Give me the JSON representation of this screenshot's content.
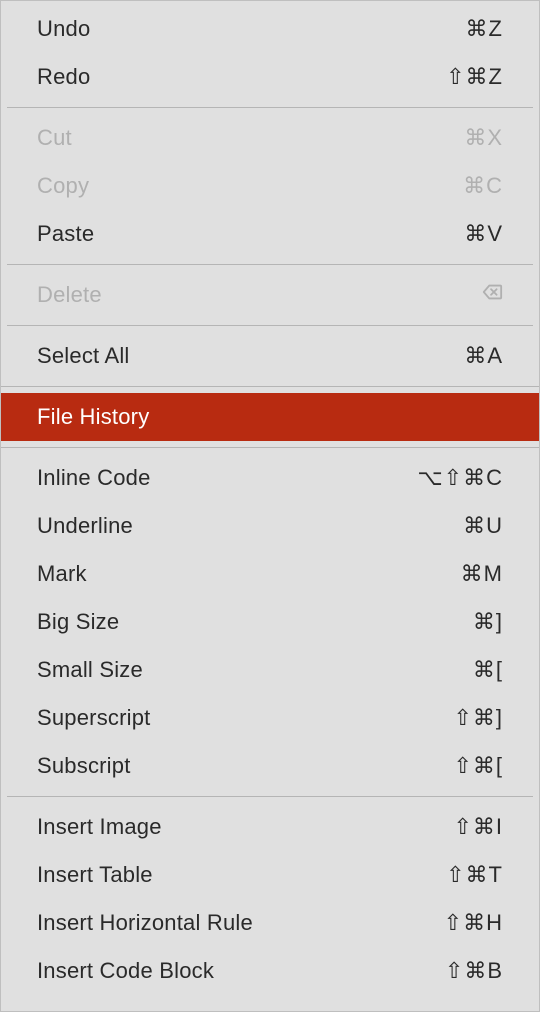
{
  "menu": {
    "groups": [
      [
        {
          "label": "Undo",
          "shortcut": "⌘Z",
          "disabled": false
        },
        {
          "label": "Redo",
          "shortcut": "⇧⌘Z",
          "disabled": false
        }
      ],
      [
        {
          "label": "Cut",
          "shortcut": "⌘X",
          "disabled": true
        },
        {
          "label": "Copy",
          "shortcut": "⌘C",
          "disabled": true
        },
        {
          "label": "Paste",
          "shortcut": "⌘V",
          "disabled": false
        }
      ],
      [
        {
          "label": "Delete",
          "shortcut_icon": "delete-backspace",
          "disabled": true
        }
      ],
      [
        {
          "label": "Select All",
          "shortcut": "⌘A",
          "disabled": false
        }
      ],
      [
        {
          "label": "File History",
          "shortcut": "",
          "disabled": false,
          "highlight": true
        }
      ],
      [
        {
          "label": "Inline Code",
          "shortcut": "⌥⇧⌘C",
          "disabled": false
        },
        {
          "label": "Underline",
          "shortcut": "⌘U",
          "disabled": false
        },
        {
          "label": "Mark",
          "shortcut": "⌘M",
          "disabled": false
        },
        {
          "label": "Big Size",
          "shortcut": "⌘]",
          "disabled": false
        },
        {
          "label": "Small Size",
          "shortcut": "⌘[",
          "disabled": false
        },
        {
          "label": "Superscript",
          "shortcut": "⇧⌘]",
          "disabled": false
        },
        {
          "label": "Subscript",
          "shortcut": "⇧⌘[",
          "disabled": false
        }
      ],
      [
        {
          "label": "Insert Image",
          "shortcut": "⇧⌘I",
          "disabled": false
        },
        {
          "label": "Insert Table",
          "shortcut": "⇧⌘T",
          "disabled": false
        },
        {
          "label": "Insert Horizontal Rule",
          "shortcut": "⇧⌘H",
          "disabled": false
        },
        {
          "label": "Insert Code Block",
          "shortcut": "⇧⌘B",
          "disabled": false
        }
      ]
    ]
  }
}
